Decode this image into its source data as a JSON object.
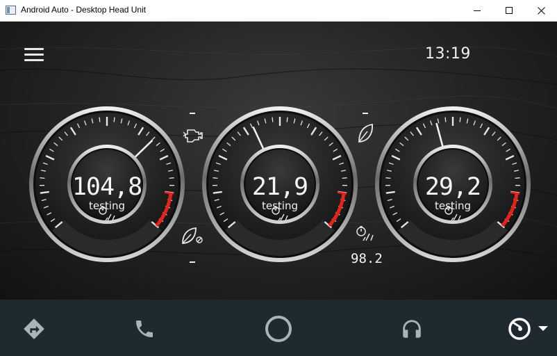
{
  "window": {
    "title": "Android Auto - Desktop Head Unit",
    "icon": "app-window-icon",
    "controls": [
      "minimize-icon",
      "maximize-icon",
      "close-icon"
    ]
  },
  "header": {
    "time": "13:19",
    "menu_icon": "hamburger-menu-icon"
  },
  "gauges": [
    {
      "value": "104,8",
      "label": "testing"
    },
    {
      "value": "21,9",
      "label": "testing"
    },
    {
      "value": "29,2",
      "label": "testing"
    }
  ],
  "side_indicators": {
    "left_top_value": "–",
    "left_bottom_value": "–",
    "right_top_value": "–",
    "right_bottom_value": "98.2"
  },
  "nav": {
    "items": [
      "navigation-icon",
      "phone-icon",
      "home-icon",
      "headphones-icon",
      "dashboard-gauge-icon"
    ]
  },
  "colors": {
    "redline": "#e8221b",
    "navbar": "#1f2a30",
    "text": "#f0f0f0"
  }
}
